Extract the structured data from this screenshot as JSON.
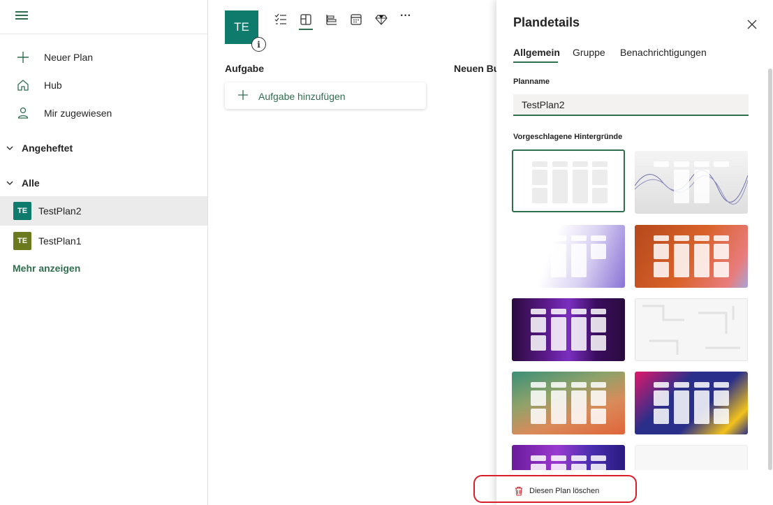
{
  "sidebar": {
    "nav": [
      {
        "label": "Neuer Plan",
        "icon": "plus-icon"
      },
      {
        "label": "Hub",
        "icon": "home-icon"
      },
      {
        "label": "Mir zugewiesen",
        "icon": "person-icon"
      }
    ],
    "sections": {
      "pinned": "Angeheftet",
      "all": "Alle"
    },
    "plans": [
      {
        "badge": "TE",
        "label": "TestPlan2",
        "color": "#0f7b6c",
        "selected": true
      },
      {
        "badge": "TE",
        "label": "TestPlan1",
        "color": "#6b7a1f",
        "selected": false
      }
    ],
    "more_link": "Mehr anzeigen"
  },
  "main": {
    "avatar": "TE",
    "info_glyph": "i",
    "columns": {
      "task": "Aufgabe",
      "new_bucket": "Neuen Bu"
    },
    "add_task": "Aufgabe hinzufügen",
    "more_glyph": "···"
  },
  "panel": {
    "title": "Plandetails",
    "tabs": [
      "Allgemein",
      "Gruppe",
      "Benachrichtigungen"
    ],
    "plan_name_label": "Planname",
    "plan_name_value": "TestPlan2",
    "backgrounds_label": "Vorgeschlagene Hintergründe",
    "delete_label": "Diesen Plan löschen"
  },
  "colors": {
    "accent": "#2f6e4e",
    "highlight": "#d81e2a"
  }
}
